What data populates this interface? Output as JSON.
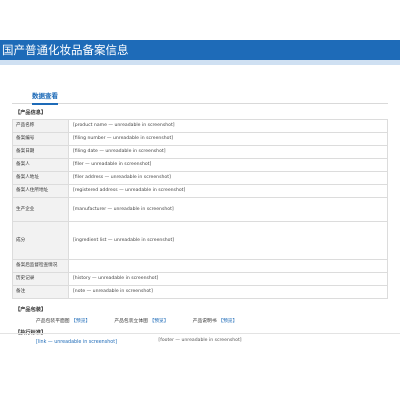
{
  "header": {
    "title": "国产普通化妆品备案信息"
  },
  "tabs": [
    {
      "label": "数据查看"
    }
  ],
  "product_section": {
    "title": "【产品信息】",
    "rows": [
      {
        "label": "产品名称",
        "value": "[product name — unreadable in screenshot]"
      },
      {
        "label": "备案编号",
        "value": "[filing number — unreadable in screenshot]"
      },
      {
        "label": "备案日期",
        "value": "[filing date — unreadable in screenshot]"
      },
      {
        "label": "备案人",
        "value": "[filer — unreadable in screenshot]"
      },
      {
        "label": "备案人地址",
        "value": "[filer address — unreadable in screenshot]"
      },
      {
        "label": "备案人住所地址",
        "value": "[registered address — unreadable in screenshot]"
      },
      {
        "label": "生产企业",
        "value": "[manufacturer — unreadable in screenshot]"
      },
      {
        "label": "成分",
        "value": "[ingredient list — unreadable in screenshot]"
      },
      {
        "label": "备案后监督检查情况",
        "value": ""
      },
      {
        "label": "历史记录",
        "value": "[history — unreadable in screenshot]"
      },
      {
        "label": "备注",
        "value": "[note — unreadable in screenshot]"
      }
    ]
  },
  "downloads_section": {
    "title": "【产品包装】",
    "items": [
      {
        "label": "产品包装平面图",
        "link": "【预览】"
      },
      {
        "label": "产品包装立体图",
        "link": "【预览】"
      },
      {
        "label": "产品说明书",
        "link": "【预览】"
      }
    ]
  },
  "exec_section": {
    "title": "【执行标准】",
    "link": "[link — unreadable in screenshot]"
  },
  "footer": {
    "text": "[footer — unreadable in screenshot]"
  }
}
